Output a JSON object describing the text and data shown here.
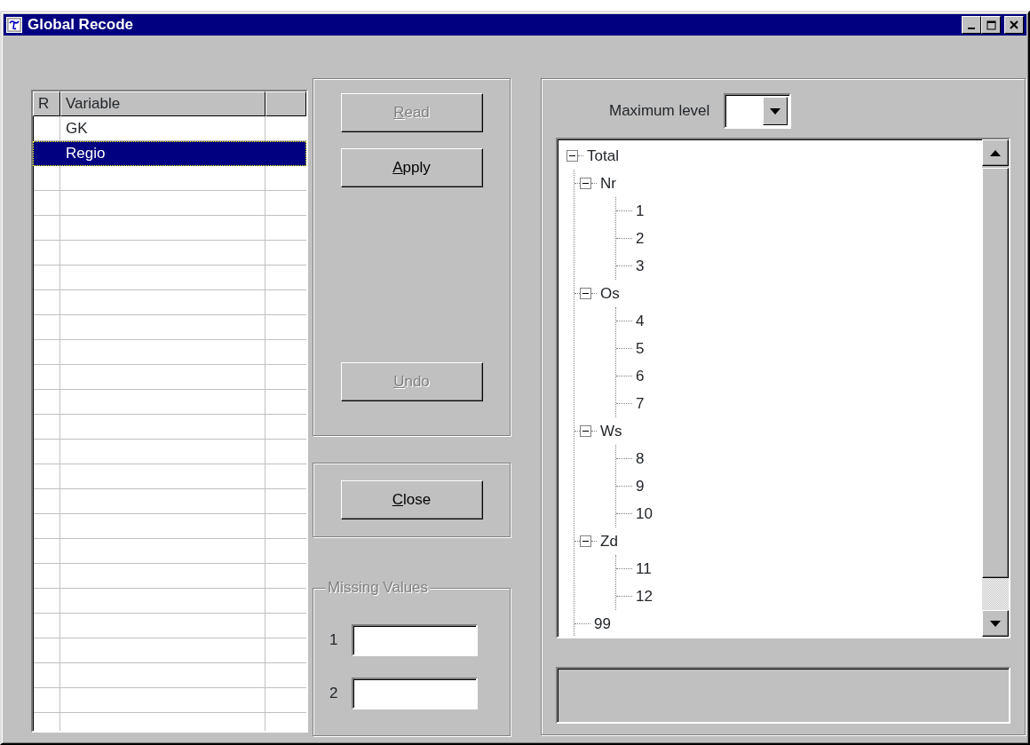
{
  "window": {
    "title": "Global Recode"
  },
  "variables_table": {
    "columns": [
      "R",
      "Variable"
    ],
    "rows": [
      {
        "variable": "GK",
        "selected": false
      },
      {
        "variable": "Regio",
        "selected": true
      }
    ]
  },
  "actions": [
    {
      "label": "Read",
      "disabled": true
    },
    {
      "label": "Apply",
      "disabled": false
    },
    {
      "label": "Undo",
      "disabled": true
    }
  ],
  "close_button": {
    "label": "Close",
    "disabled": false
  },
  "missing_values": {
    "title": "Missing Values",
    "disabled": true,
    "fields": [
      {
        "label": "1"
      },
      {
        "label": "2"
      }
    ]
  },
  "maximum_level": {
    "label": "Maximum level"
  },
  "tree": [
    {
      "label": "Total",
      "expanded": true,
      "children": [
        {
          "label": "Nr",
          "expanded": true,
          "children": [
            {
              "label": "1"
            },
            {
              "label": "2"
            },
            {
              "label": "3"
            }
          ]
        },
        {
          "label": "Os",
          "expanded": true,
          "children": [
            {
              "label": "4"
            },
            {
              "label": "5"
            },
            {
              "label": "6"
            },
            {
              "label": "7"
            }
          ]
        },
        {
          "label": "Ws",
          "expanded": true,
          "children": [
            {
              "label": "8"
            },
            {
              "label": "9"
            },
            {
              "label": "10"
            }
          ]
        },
        {
          "label": "Zd",
          "expanded": true,
          "children": [
            {
              "label": "11"
            },
            {
              "label": "12"
            }
          ]
        },
        {
          "label": "99"
        }
      ]
    }
  ]
}
